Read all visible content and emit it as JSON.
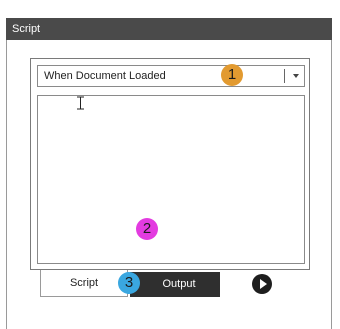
{
  "panel": {
    "title": "Script"
  },
  "event_select": {
    "selected": "When Document Loaded",
    "icon": "chevron-down-icon"
  },
  "editor": {
    "content": "",
    "cursor_icon": "i-beam-cursor-icon"
  },
  "tabs": [
    {
      "label": "Script",
      "active": true
    },
    {
      "label": "Output",
      "active": false
    }
  ],
  "run_button": {
    "icon": "play-icon"
  },
  "callouts": [
    {
      "number": "1",
      "color": "#e29a30"
    },
    {
      "number": "2",
      "color": "#e33be0"
    },
    {
      "number": "3",
      "color": "#3aa7e0"
    }
  ],
  "colors": {
    "titlebar": "#4a4a4a",
    "active_tab_dark": "#2f2f2f"
  }
}
